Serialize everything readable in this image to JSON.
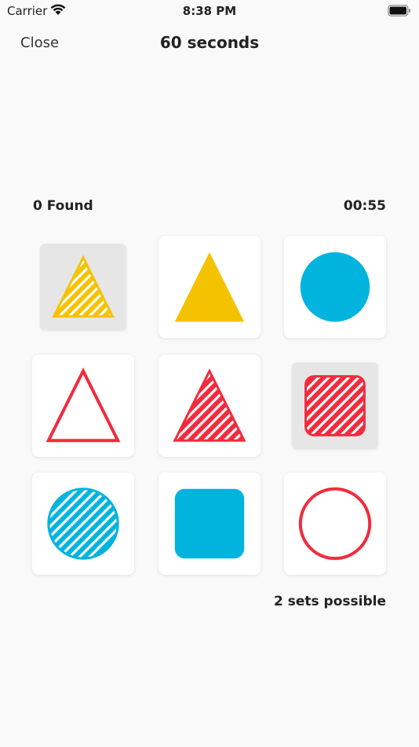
{
  "status_bar": {
    "carrier": "Carrier",
    "time": "8:38 PM",
    "wifi_icon": "wifi-icon",
    "battery_icon": "battery-icon"
  },
  "nav": {
    "close_label": "Close",
    "title": "60 seconds"
  },
  "game": {
    "found_label": "0 Found",
    "timer": "00:55",
    "sets_possible_label": "2 sets possible"
  },
  "colors": {
    "yellow": "#f5c200",
    "blue": "#00b4de",
    "red": "#f22b3d",
    "selected_card_bg": "#e6e6e6",
    "card_bg": "#ffffff"
  },
  "cards": [
    {
      "shape": "triangle",
      "color": "yellow",
      "fill": "striped",
      "selected": true
    },
    {
      "shape": "triangle",
      "color": "yellow",
      "fill": "solid",
      "selected": false
    },
    {
      "shape": "circle",
      "color": "blue",
      "fill": "solid",
      "selected": false
    },
    {
      "shape": "triangle",
      "color": "red",
      "fill": "outline",
      "selected": false
    },
    {
      "shape": "triangle",
      "color": "red",
      "fill": "striped",
      "selected": false
    },
    {
      "shape": "square",
      "color": "red",
      "fill": "striped",
      "selected": true
    },
    {
      "shape": "circle",
      "color": "blue",
      "fill": "striped",
      "selected": false
    },
    {
      "shape": "square",
      "color": "blue",
      "fill": "solid",
      "selected": false
    },
    {
      "shape": "circle",
      "color": "red",
      "fill": "outline",
      "selected": false
    }
  ]
}
